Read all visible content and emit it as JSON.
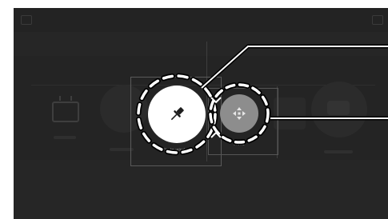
{
  "screen": {
    "background": "#262626",
    "topbar": {
      "left_icon": "window-control-icon",
      "right_icon": "window-control-icon"
    }
  },
  "tools": [
    {
      "icon": "pin-icon",
      "state": "active",
      "fill": "#ffffff",
      "caption": "Pin to window"
    },
    {
      "icon": "move-icon",
      "state": "hover",
      "fill": "#8d8d8d",
      "caption": "Move"
    }
  ],
  "background_items": [
    {
      "icon": "tv-icon"
    },
    {
      "icon": "circle-item-icon"
    },
    {
      "icon": "square-item-icon"
    },
    {
      "icon": "circle-item-icon"
    }
  ],
  "colors": {
    "dash": "#ffffff",
    "callout_line": "#ffffff",
    "selection_border": "#5a5a5a"
  }
}
